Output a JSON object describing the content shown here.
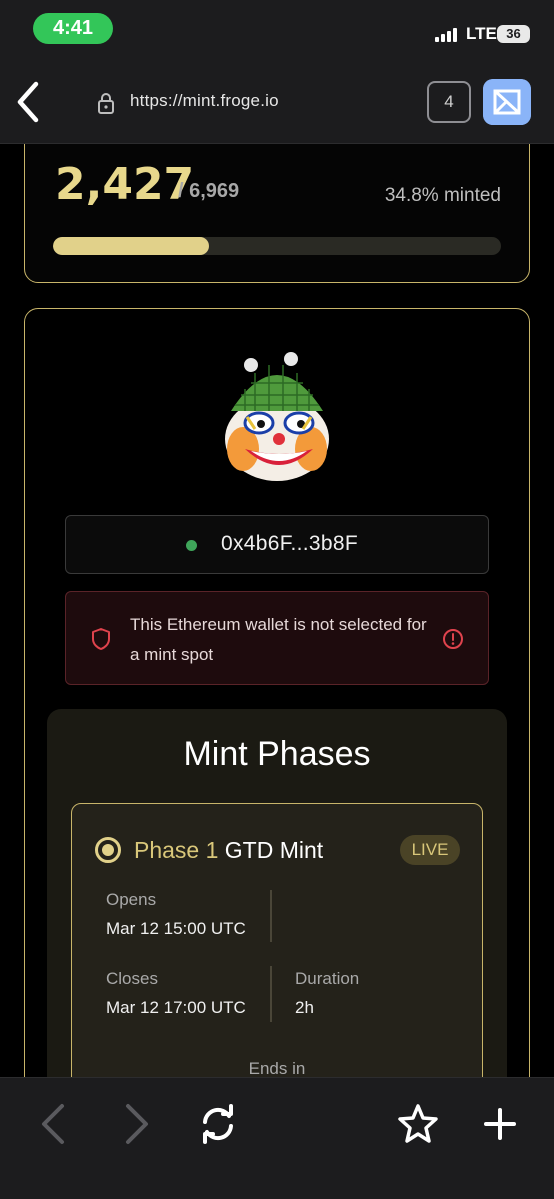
{
  "status_bar": {
    "time": "4:41",
    "network": "LTE",
    "battery": "36"
  },
  "browser": {
    "url": "https://mint.froge.io",
    "tab_count": "4"
  },
  "progress": {
    "minted": "2,427",
    "total": "/ 6,969",
    "percent_label": "34.8% minted",
    "fraction": 0.348
  },
  "wallet": {
    "address": "0x4b6F...3b8F",
    "alert": "This Ethereum wallet is not selected for a mint spot"
  },
  "phases": {
    "title": "Mint Phases",
    "phase": {
      "number": "Phase 1",
      "type": "GTD Mint",
      "status": "LIVE",
      "opens_label": "Opens",
      "opens_value": "Mar 12 15:00 UTC",
      "closes_label": "Closes",
      "closes_value": "Mar 12 17:00 UTC",
      "duration_label": "Duration",
      "duration_value": "2h",
      "ends_in_label": "Ends in"
    }
  },
  "colors": {
    "accent_gold": "#e1d18a",
    "status_green": "#33c659",
    "alert_red": "#e0434d"
  },
  "icons": [
    "back-icon",
    "lock-icon",
    "shield-icon",
    "info-icon",
    "reload-icon",
    "star-icon",
    "plus-icon",
    "chevron-left-icon",
    "chevron-right-icon"
  ]
}
